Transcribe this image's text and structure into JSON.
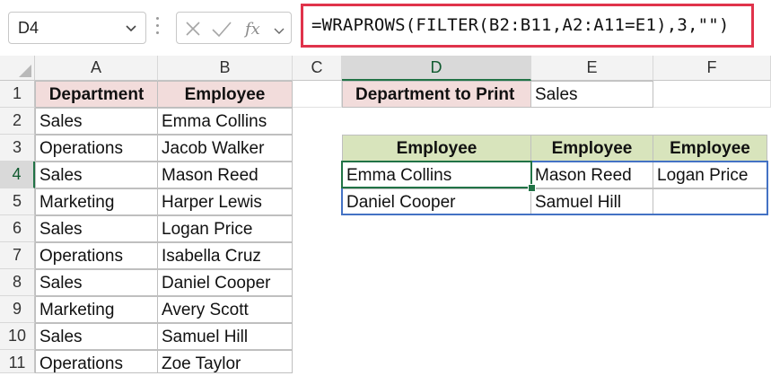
{
  "formula_bar": {
    "name_box": "D4",
    "formula": "=WRAPROWS(FILTER(B2:B11,A2:A11=E1),3,\"\")"
  },
  "columns": [
    "A",
    "B",
    "C",
    "D",
    "E",
    "F"
  ],
  "selected_column": "D",
  "rows": [
    "1",
    "2",
    "3",
    "4",
    "5",
    "6",
    "7",
    "8",
    "9",
    "10",
    "11"
  ],
  "selected_row": "4",
  "table": {
    "headers": [
      "Department",
      "Employee"
    ],
    "rows": [
      [
        "Sales",
        "Emma Collins"
      ],
      [
        "Operations",
        "Jacob Walker"
      ],
      [
        "Sales",
        "Mason Reed"
      ],
      [
        "Marketing",
        "Harper Lewis"
      ],
      [
        "Sales",
        "Logan Price"
      ],
      [
        "Operations",
        "Isabella Cruz"
      ],
      [
        "Sales",
        "Daniel Cooper"
      ],
      [
        "Marketing",
        "Avery Scott"
      ],
      [
        "Sales",
        "Samuel Hill"
      ],
      [
        "Operations",
        "Zoe Taylor"
      ]
    ]
  },
  "criteria": {
    "label": "Department to Print",
    "value": "Sales"
  },
  "result": {
    "headers": [
      "Employee",
      "Employee",
      "Employee"
    ],
    "rows": [
      [
        "Emma Collins",
        "Mason Reed",
        "Logan Price"
      ],
      [
        "Daniel Cooper",
        "Samuel Hill",
        ""
      ]
    ]
  },
  "colors": {
    "header_pink": "#f2dcdb",
    "header_green": "#d8e4bc",
    "formula_border": "#e0334b",
    "selection_green": "#217346",
    "spill_blue": "#4472c4"
  },
  "icons": [
    "chevron-down-icon",
    "cancel-icon",
    "enter-icon",
    "insert-function-icon"
  ]
}
